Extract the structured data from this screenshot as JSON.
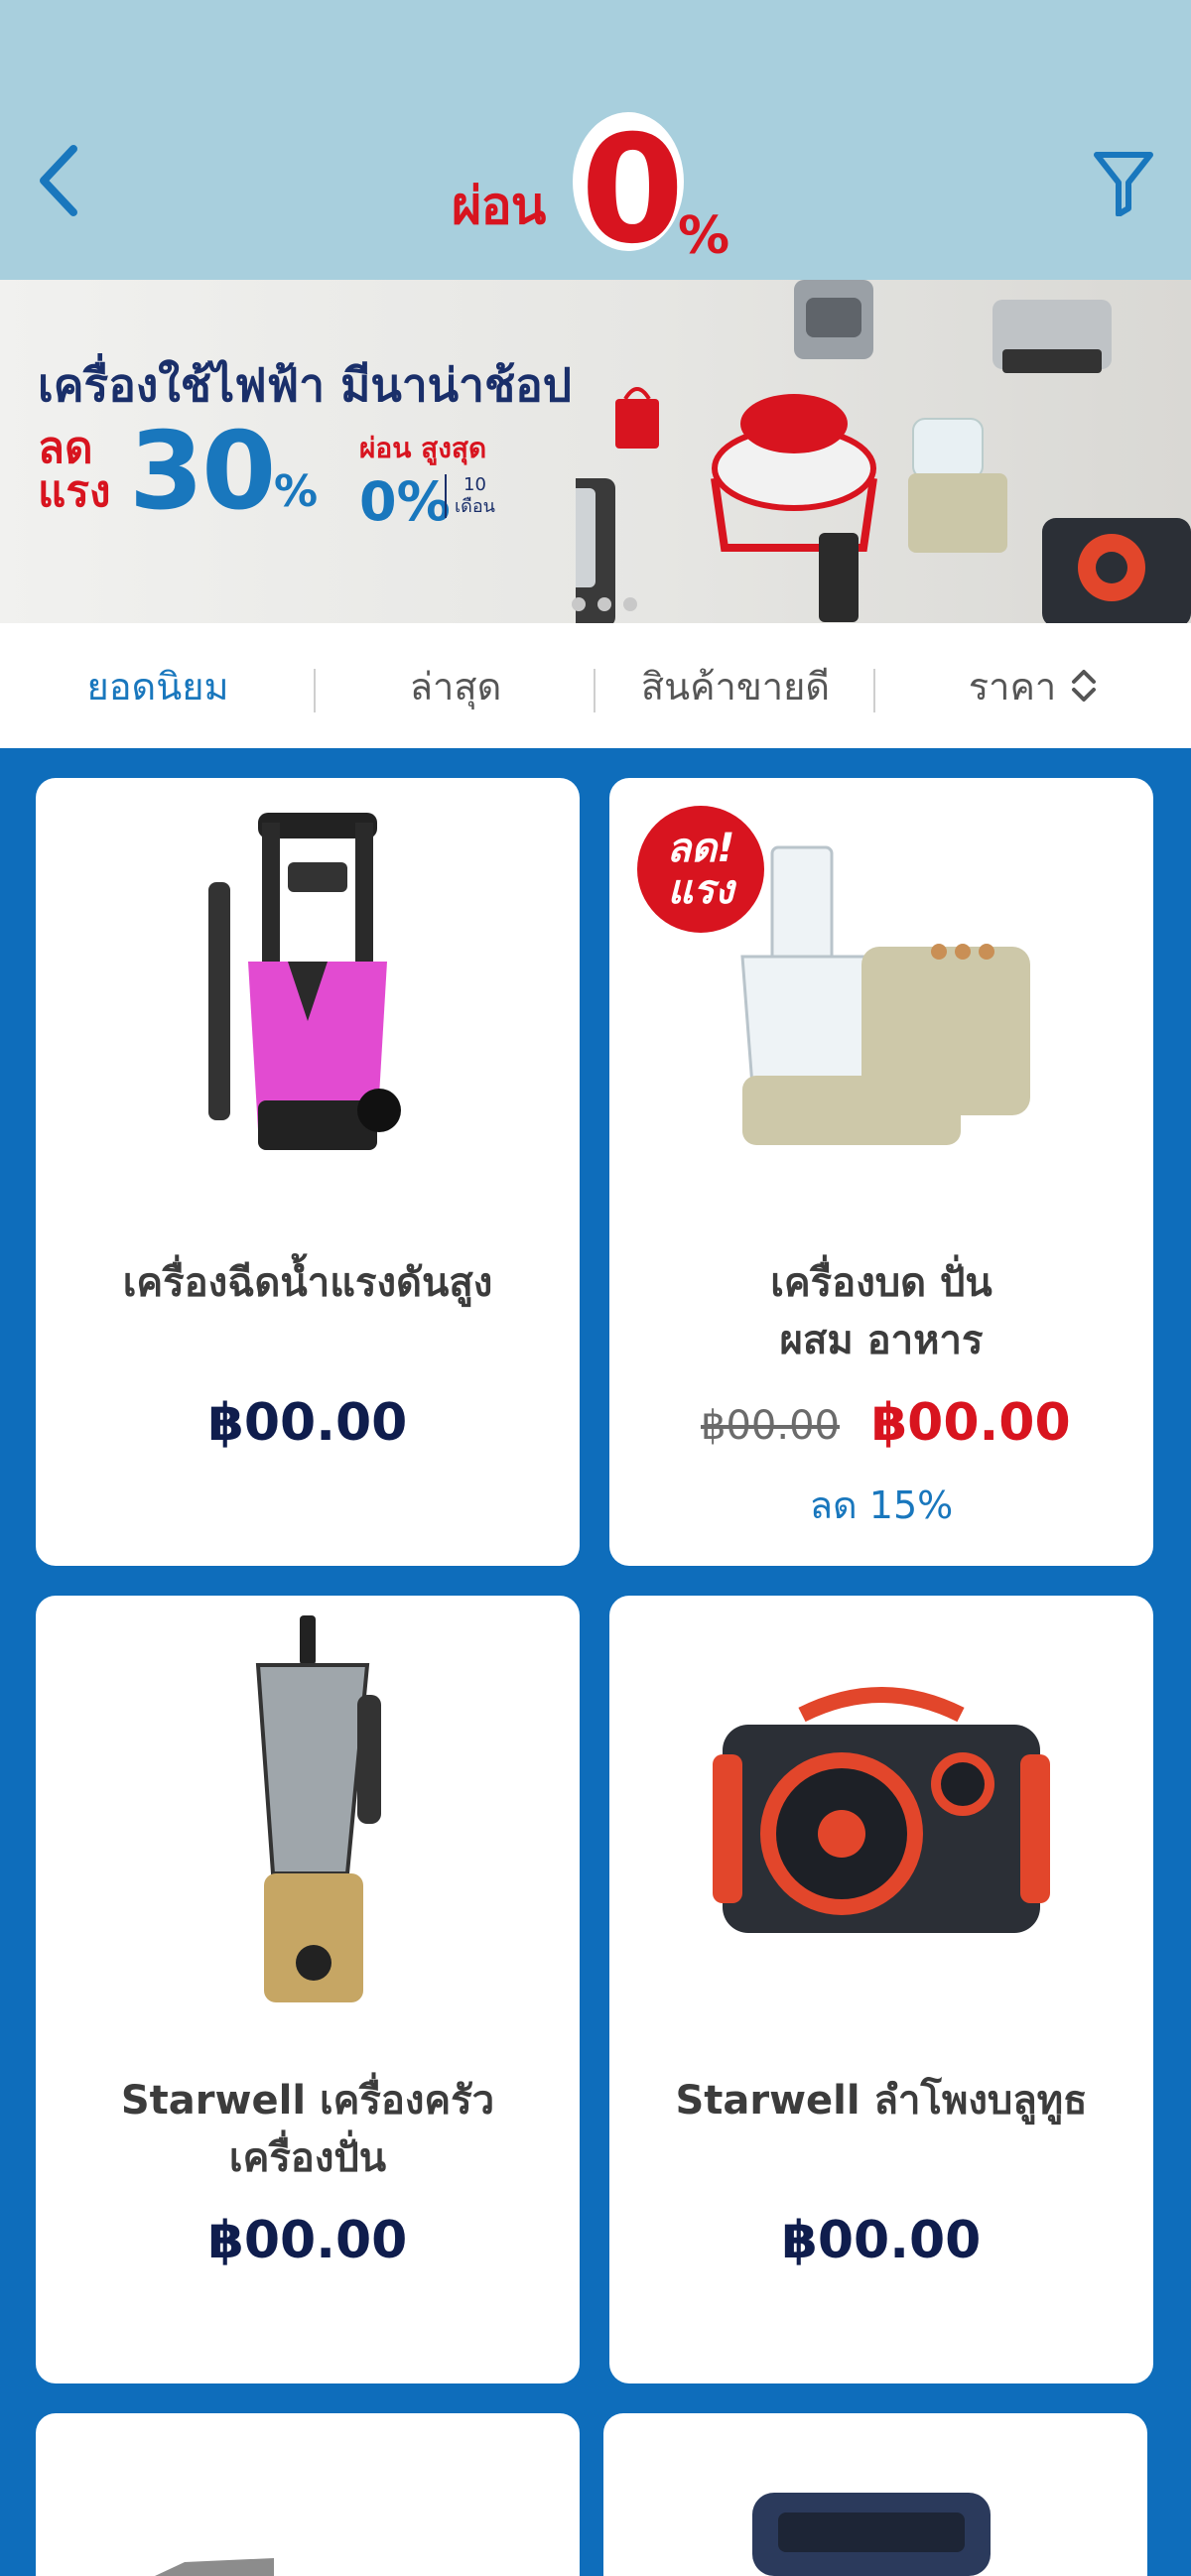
{
  "header": {
    "logo_text": "ผ่อน",
    "logo_zero": "0",
    "logo_pct": "%"
  },
  "banner": {
    "title": "เครื่องใช้ไฟฟ้า มีนาน่าช้อป",
    "discount_label_1": "ลด",
    "discount_label_2": "แรง",
    "discount_value": "30",
    "discount_pct": "%",
    "installment_label": "ผ่อน สูงสุด",
    "installment_value": "0%",
    "months_value": "10",
    "months_label": "เดือน"
  },
  "sort": {
    "items": [
      {
        "label": "ยอดนิยม",
        "active": true
      },
      {
        "label": "ล่าสุด",
        "active": false
      },
      {
        "label": "สินค้าขายดี",
        "active": false
      },
      {
        "label": "ราคา",
        "active": false
      }
    ]
  },
  "products": [
    {
      "name": "เครื่องฉีดน้ำแรงดันสูง",
      "price": "฿00.00"
    },
    {
      "name_1": "เครื่องบด ปั่น",
      "name_2": "ผสม อาหาร",
      "badge_1": "ลด!",
      "badge_2": "แรง",
      "old_price": "฿00.00",
      "sale_price": "฿00.00",
      "discount": "ลด 15%"
    },
    {
      "name_1": "Starwell เครื่องครัว",
      "name_2": "เครื่องปั่น",
      "price": "฿00.00"
    },
    {
      "name": "Starwell ลำโพงบลูทูธ",
      "price": "฿00.00"
    }
  ],
  "colors": {
    "header_bg": "#a8cfdd",
    "page_bg": "#0e6dbb",
    "accent_blue": "#1977bd",
    "accent_red": "#d8141f",
    "price_navy": "#0f1d4d"
  }
}
